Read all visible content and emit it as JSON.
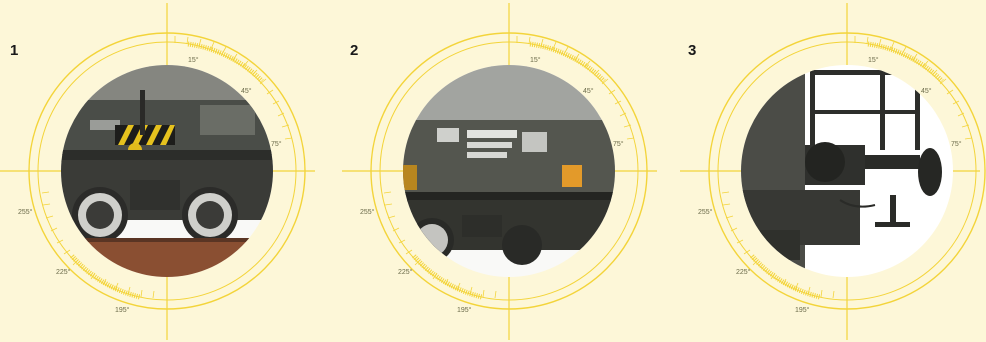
{
  "panels": [
    {
      "number": "1",
      "photo_subject": "freight wagon bogie, side view",
      "angles": {
        "a15": "15°",
        "a45": "45°",
        "a75": "75°",
        "a255": "255°",
        "a225": "225°",
        "a195": "195°"
      }
    },
    {
      "number": "2",
      "photo_subject": "freight wagon side panel with data plates",
      "angles": {
        "a15": "15°",
        "a45": "45°",
        "a75": "75°",
        "a255": "255°",
        "a225": "225°",
        "a195": "195°"
      }
    },
    {
      "number": "3",
      "photo_subject": "wagon end with buffer",
      "angles": {
        "a15": "15°",
        "a45": "45°",
        "a75": "75°",
        "a255": "255°",
        "a225": "225°",
        "a195": "195°"
      }
    }
  ],
  "colors": {
    "background": "#fdf7d8",
    "dial": "#f3d43a",
    "number": "#1a1a1a"
  }
}
